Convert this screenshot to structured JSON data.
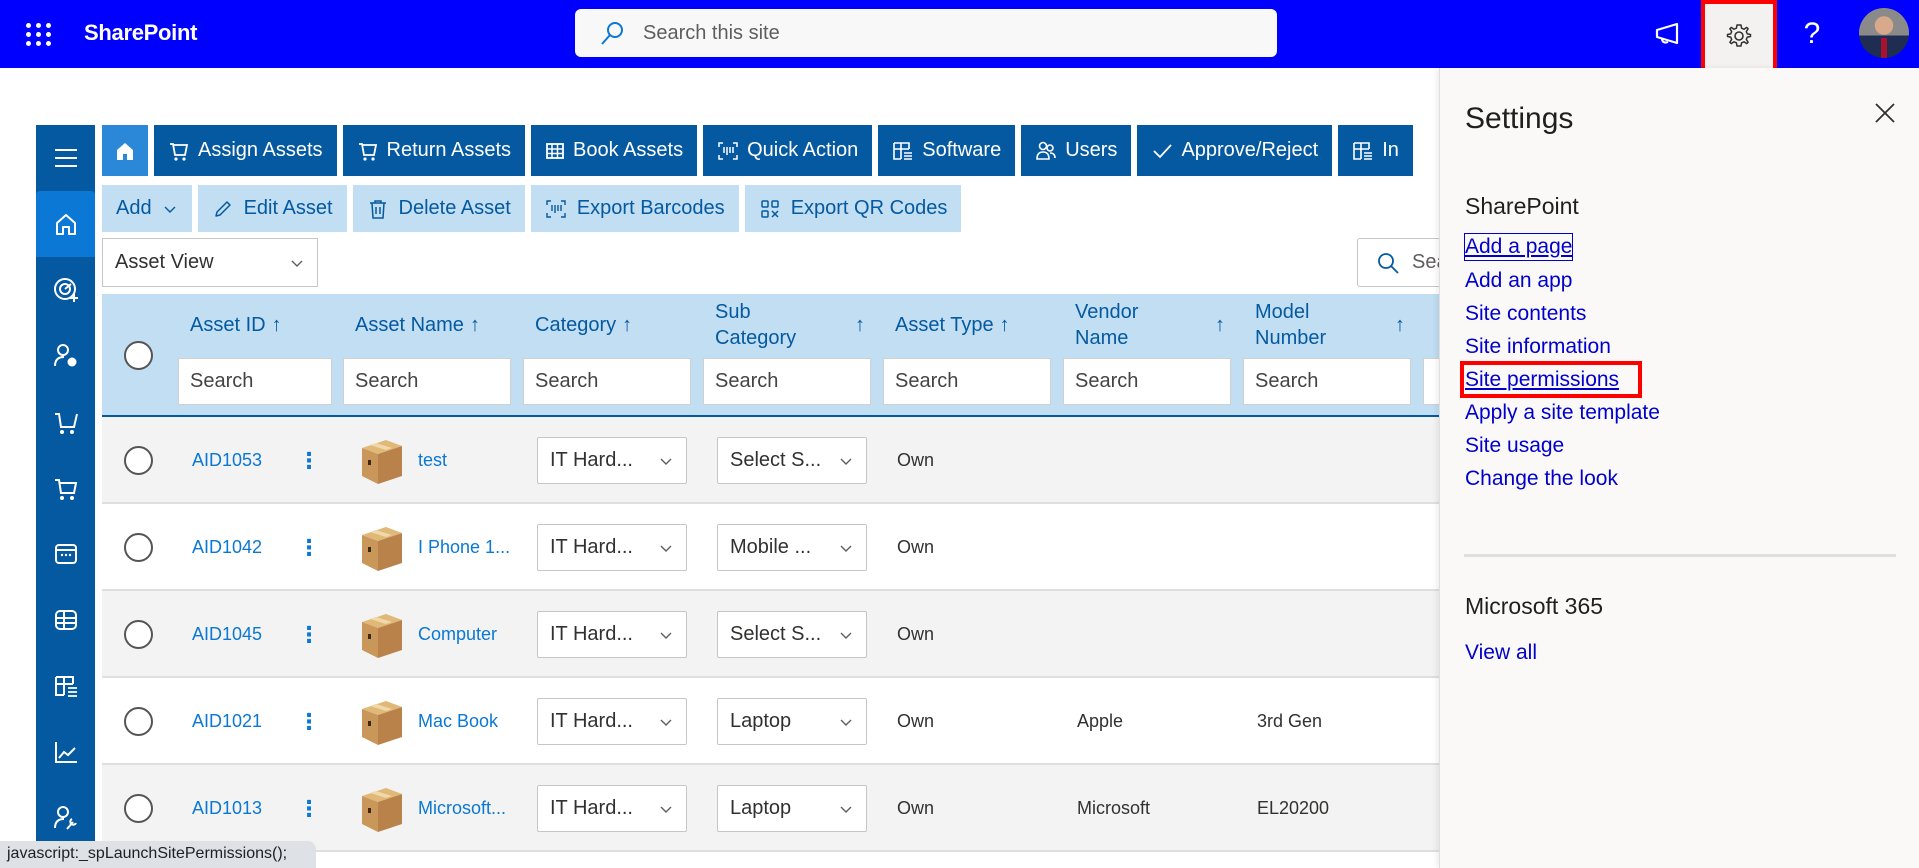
{
  "topbar": {
    "app_name": "SharePoint",
    "search_placeholder": "Search this site",
    "icons": [
      "waffle-icon",
      "megaphone-icon",
      "gear-icon",
      "help-icon",
      "avatar"
    ],
    "help_glyph": "?",
    "accent": "#0000ff"
  },
  "sidebar": {
    "items": [
      {
        "icon": "hamburger-icon"
      },
      {
        "icon": "home-icon",
        "active": true
      },
      {
        "icon": "dashboard-add-icon"
      },
      {
        "icon": "user-settings-icon"
      },
      {
        "icon": "cart-assign-icon"
      },
      {
        "icon": "cart-return-icon"
      },
      {
        "icon": "calendar-icon"
      },
      {
        "icon": "table-icon"
      },
      {
        "icon": "grid-list-icon"
      },
      {
        "icon": "chart-line-icon"
      },
      {
        "icon": "user-wrench-icon"
      }
    ]
  },
  "nav": {
    "primary": [
      {
        "label": "Assign Assets",
        "icon": "cart-icon"
      },
      {
        "label": "Return Assets",
        "icon": "cart-icon"
      },
      {
        "label": "Book Assets",
        "icon": "table-icon"
      },
      {
        "label": "Quick Action",
        "icon": "barcode-scan-icon"
      },
      {
        "label": "Software",
        "icon": "grid-list-icon"
      },
      {
        "label": "Users",
        "icon": "people-icon"
      },
      {
        "label": "Approve/Reject",
        "icon": "check-icon"
      },
      {
        "label": "In",
        "icon": "grid-list-icon"
      }
    ],
    "actions": [
      {
        "label": "Add",
        "icon": "chevron-down-icon"
      },
      {
        "label": "Edit Asset",
        "icon": "pencil-icon"
      },
      {
        "label": "Delete Asset",
        "icon": "trash-icon"
      },
      {
        "label": "Export Barcodes",
        "icon": "barcode-icon"
      },
      {
        "label": "Export QR Codes",
        "icon": "qr-code-icon"
      }
    ]
  },
  "view": {
    "selected": "Asset View"
  },
  "list_search": {
    "placeholder": "Sea"
  },
  "table": {
    "columns": [
      {
        "label": "Asset ID",
        "sort": "↑",
        "filter_placeholder": "Search"
      },
      {
        "label": "Asset Name",
        "sort": "↑",
        "filter_placeholder": "Search"
      },
      {
        "label": "Category",
        "sort": "↑",
        "filter_placeholder": "Search"
      },
      {
        "label": "Sub Category",
        "sort": "↑",
        "filter_placeholder": "Search"
      },
      {
        "label": "Asset Type",
        "sort": "↑",
        "filter_placeholder": "Search"
      },
      {
        "label": "Vendor Name",
        "sort": "↑",
        "filter_placeholder": "Search"
      },
      {
        "label": "Model Number",
        "sort": "↑",
        "filter_placeholder": "Search"
      }
    ],
    "rows": [
      {
        "id": "AID1053",
        "name": "test",
        "category": "IT Hard...",
        "sub_category": "Select S...",
        "type": "Own",
        "vendor": "",
        "model": ""
      },
      {
        "id": "AID1042",
        "name": "I Phone 1...",
        "category": "IT Hard...",
        "sub_category": "Mobile ...",
        "type": "Own",
        "vendor": "",
        "model": ""
      },
      {
        "id": "AID1045",
        "name": "Computer",
        "category": "IT Hard...",
        "sub_category": "Select S...",
        "type": "Own",
        "vendor": "",
        "model": ""
      },
      {
        "id": "AID1021",
        "name": "Mac Book",
        "category": "IT Hard...",
        "sub_category": "Laptop",
        "type": "Own",
        "vendor": "Apple",
        "model": "3rd Gen"
      },
      {
        "id": "AID1013",
        "name": "Microsoft...",
        "category": "IT Hard...",
        "sub_category": "Laptop",
        "type": "Own",
        "vendor": "Microsoft",
        "model": "EL20200"
      }
    ],
    "kebab": "⋮"
  },
  "settings_panel": {
    "title": "Settings",
    "sharepoint_heading": "SharePoint",
    "links": [
      "Add a page",
      "Add an app",
      "Site contents",
      "Site information",
      "Site permissions",
      "Apply a site template",
      "Site usage",
      "Change the look"
    ],
    "highlighted_link": "Site permissions",
    "m365_heading": "Microsoft 365",
    "view_all": "View all"
  },
  "status_bar": "javascript:_spLaunchSitePermissions();"
}
